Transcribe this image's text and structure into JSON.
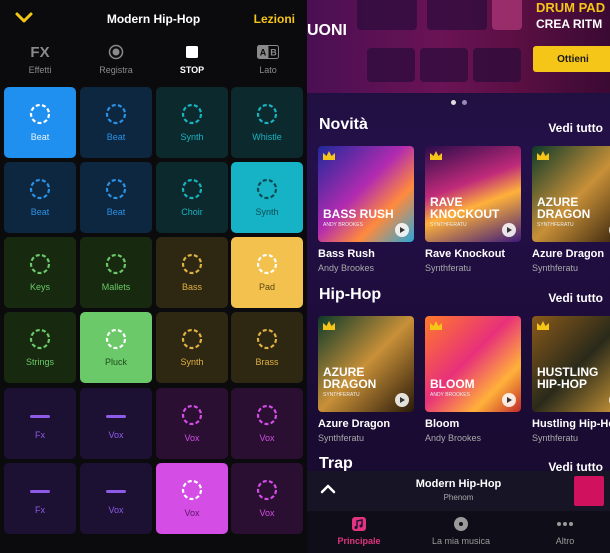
{
  "colors": {
    "accent_yellow": "#f5c518",
    "accent_pink": "#e0347e",
    "pad_blue_active": "#1f8ff0",
    "pad_teal_active": "#16b3c6",
    "pad_yellow_active": "#f2c14e",
    "pad_green_active": "#6cc96a",
    "pad_purple_active": "#d44ee6"
  },
  "left": {
    "header": {
      "title": "Modern Hip-Hop",
      "lessons": "Lezioni"
    },
    "toolbar": [
      {
        "icon": "fx-icon",
        "glyph": "FX",
        "label": "Effetti",
        "active": false
      },
      {
        "icon": "record-icon",
        "label": "Registra",
        "active": false
      },
      {
        "icon": "stop-icon",
        "label": "STOP",
        "active": true
      },
      {
        "icon": "side-ab-icon",
        "label": "Lato",
        "active": false
      }
    ],
    "pads": [
      [
        {
          "label": "Beat",
          "kind": "ring",
          "bg": "#1f8ff0",
          "ring": "#ffffff",
          "text": "#e9f4ff"
        },
        {
          "label": "Beat",
          "kind": "ring",
          "bg": "#0e2740",
          "ring": "#2a92e6",
          "text": "#2a92e6"
        },
        {
          "label": "Synth",
          "kind": "ring",
          "bg": "#0c2a2d",
          "ring": "#19b3c2",
          "text": "#19b3c2"
        },
        {
          "label": "Whistle",
          "kind": "ring",
          "bg": "#0c2a2d",
          "ring": "#19b3c2",
          "text": "#19b3c2"
        }
      ],
      [
        {
          "label": "Beat",
          "kind": "ring",
          "bg": "#0e2740",
          "ring": "#2a92e6",
          "text": "#2a92e6"
        },
        {
          "label": "Beat",
          "kind": "ring",
          "bg": "#0e2740",
          "ring": "#2a92e6",
          "text": "#2a92e6"
        },
        {
          "label": "Choir",
          "kind": "ring",
          "bg": "#0c2a2d",
          "ring": "#19b3c2",
          "text": "#19b3c2"
        },
        {
          "label": "Synth",
          "kind": "ring",
          "bg": "#16b3c6",
          "ring": "#0a4a52",
          "text": "#0a4a52"
        }
      ],
      [
        {
          "label": "Keys",
          "kind": "ring",
          "bg": "#17290f",
          "ring": "#6cc96a",
          "text": "#6cc96a"
        },
        {
          "label": "Mallets",
          "kind": "ring",
          "bg": "#17290f",
          "ring": "#6cc96a",
          "text": "#6cc96a"
        },
        {
          "label": "Bass",
          "kind": "ring",
          "bg": "#2e2712",
          "ring": "#e0b143",
          "text": "#e0b143"
        },
        {
          "label": "Pad",
          "kind": "ring",
          "bg": "#f2c14e",
          "ring": "#ffffff",
          "text": "#5b4510"
        }
      ],
      [
        {
          "label": "Strings",
          "kind": "ring",
          "bg": "#17290f",
          "ring": "#6cc96a",
          "text": "#6cc96a"
        },
        {
          "label": "Pluck",
          "kind": "ring",
          "bg": "#6cc96a",
          "ring": "#ffffff",
          "text": "#1d4a1c"
        },
        {
          "label": "Synth",
          "kind": "ring",
          "bg": "#2e2712",
          "ring": "#e0b143",
          "text": "#e0b143"
        },
        {
          "label": "Brass",
          "kind": "ring",
          "bg": "#2e2712",
          "ring": "#e0b143",
          "text": "#e0b143"
        }
      ],
      [
        {
          "label": "Fx",
          "kind": "line",
          "bg": "#1d1133",
          "ring": "#8e5be8",
          "text": "#8e5be8"
        },
        {
          "label": "Vox",
          "kind": "line",
          "bg": "#1d1133",
          "ring": "#8e5be8",
          "text": "#8e5be8"
        },
        {
          "label": "Vox",
          "kind": "ring",
          "bg": "#2a0f32",
          "ring": "#d44ee6",
          "text": "#d44ee6"
        },
        {
          "label": "Vox",
          "kind": "ring",
          "bg": "#2a0f32",
          "ring": "#d44ee6",
          "text": "#d44ee6"
        }
      ],
      [
        {
          "label": "Fx",
          "kind": "line",
          "bg": "#1d1133",
          "ring": "#8e5be8",
          "text": "#8e5be8"
        },
        {
          "label": "Vox",
          "kind": "line",
          "bg": "#1d1133",
          "ring": "#8e5be8",
          "text": "#8e5be8"
        },
        {
          "label": "Vox",
          "kind": "ring",
          "bg": "#d44ee6",
          "ring": "#ffffff",
          "text": "#5a1466"
        },
        {
          "label": "Vox",
          "kind": "ring",
          "bg": "#2a0f32",
          "ring": "#d44ee6",
          "text": "#d44ee6"
        }
      ]
    ]
  },
  "right": {
    "banner": {
      "left_text": "UONI",
      "title": "DRUM PAD",
      "subtitle": "CREA RITM",
      "cta": "Ottieni"
    },
    "sections": [
      {
        "title": "Novità",
        "more": "Vedi tutto",
        "cards": [
          {
            "title": "Bass Rush",
            "author": "Andy Brookes",
            "art_text": "BASS RUSH",
            "art_sub": "ANDY BROOKES",
            "premium": true
          },
          {
            "title": "Rave Knockout",
            "author": "Synthferatu",
            "art_text": "RAVE KNOCKOUT",
            "art_sub": "SYNTHFERATU",
            "premium": true
          },
          {
            "title": "Azure Dragon",
            "author": "Synthferatu",
            "art_text": "AZURE DRAGON",
            "art_sub": "SYNTHFERATU",
            "premium": true
          }
        ]
      },
      {
        "title": "Hip-Hop",
        "more": "Vedi tutto",
        "cards": [
          {
            "title": "Azure Dragon",
            "author": "Synthferatu",
            "art_text": "AZURE DRAGON",
            "art_sub": "SYNTHFERATU",
            "premium": true
          },
          {
            "title": "Bloom",
            "author": "Andy Brookes",
            "art_text": "BLOOM",
            "art_sub": "ANDY BROOKES",
            "premium": true
          },
          {
            "title": "Hustling Hip-Hop",
            "author": "Synthferatu",
            "art_text": "HUSTLING HIP-HOP",
            "art_sub": "",
            "premium": true
          }
        ]
      },
      {
        "title": "Trap",
        "more": "Vedi tutto",
        "cards": []
      }
    ],
    "player": {
      "title": "Modern Hip-Hop",
      "artist": "Phenom"
    },
    "nav": [
      {
        "icon": "music-note-icon",
        "label": "Principale",
        "active": true
      },
      {
        "icon": "disc-icon",
        "label": "La mia musica",
        "active": false
      },
      {
        "icon": "more-icon",
        "label": "Altro",
        "active": false
      }
    ]
  }
}
